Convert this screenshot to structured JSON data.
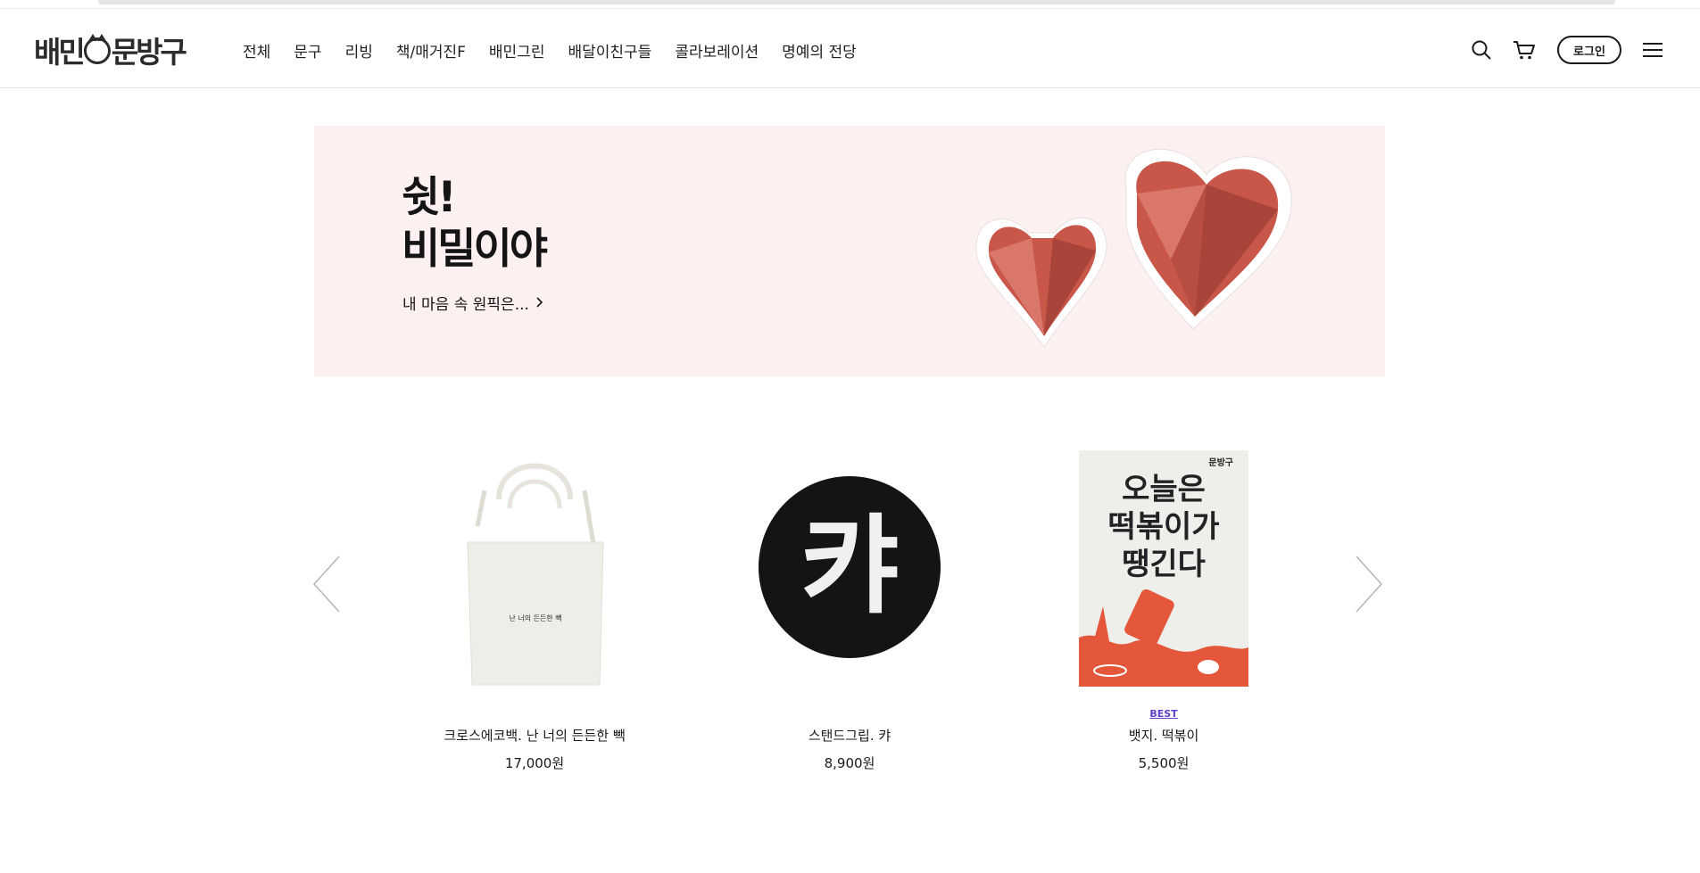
{
  "header": {
    "logo_text": "배민문방구",
    "nav": [
      "전체",
      "문구",
      "리빙",
      "책/매거진F",
      "배민그린",
      "배달이친구들",
      "콜라보레이션",
      "명예의 전당"
    ],
    "login_label": "로그인",
    "icons": [
      "search-icon",
      "cart-icon",
      "menu-icon"
    ]
  },
  "banner": {
    "title_line1": "쉿!",
    "title_line2": "비밀이야",
    "subtitle": "내 마음 속 원픽은...",
    "background": "#fdf0f0",
    "heart_color": "#c8574a"
  },
  "carousel": {
    "products": [
      {
        "badge": "",
        "name": "크로스에코백. 난 너의 든든한 빽",
        "price": "17,000원",
        "image_text": "난 너의 든든한 빽"
      },
      {
        "badge": "",
        "name": "스탠드그립. 캬",
        "price": "8,900원",
        "image_text": "캬"
      },
      {
        "badge": "BEST",
        "name": "뱃지. 떡볶이",
        "price": "5,500원",
        "image_text": "오늘은 떡볶이가 땡긴다",
        "image_brand": "문방구"
      }
    ],
    "accent": "#5b3fd0"
  }
}
